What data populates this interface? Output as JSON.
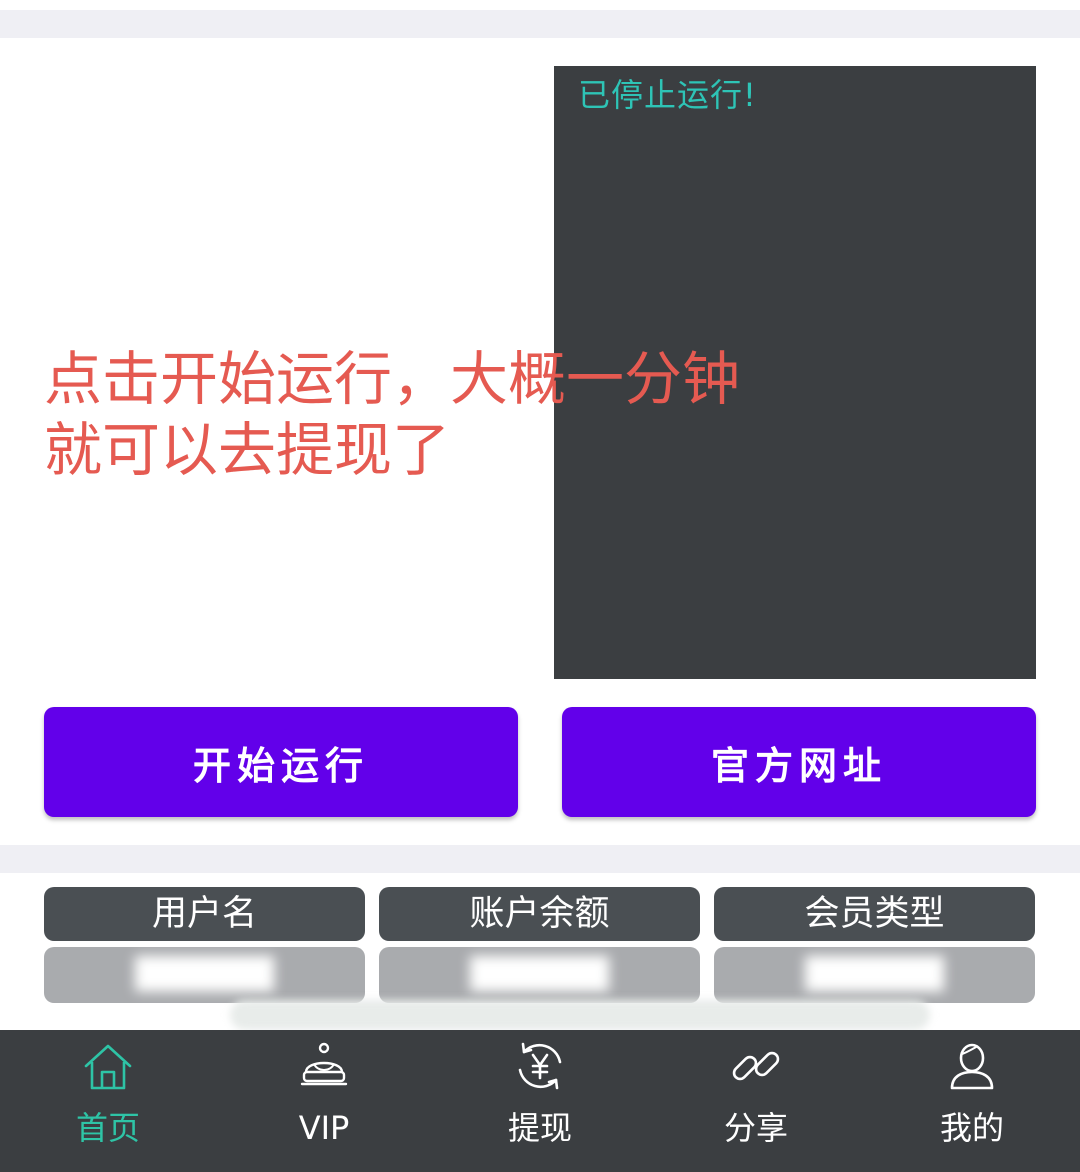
{
  "console": {
    "status_text": "已停止运行!"
  },
  "overlay_note": {
    "line1": "点击开始运行，大概一分钟",
    "line2": "就可以去提现了"
  },
  "actions": {
    "start_label": "开始运行",
    "site_label": "官方网址"
  },
  "account_info": {
    "headers": [
      "用户名",
      "账户余额",
      "会员类型"
    ],
    "values": [
      "██████",
      "██████",
      "██████"
    ]
  },
  "tabbar": {
    "active_index": 0,
    "items": [
      {
        "label": "首页",
        "icon": "home-icon"
      },
      {
        "label": "VIP",
        "icon": "crown-icon"
      },
      {
        "label": "提现",
        "icon": "yuan-exchange-icon"
      },
      {
        "label": "分享",
        "icon": "link-icon"
      },
      {
        "label": "我的",
        "icon": "user-icon"
      }
    ]
  },
  "colors": {
    "accent_button": "#6200ea",
    "console_bg": "#3b3e41",
    "status_text": "#2ec4b6",
    "tab_active": "#2ec4a6",
    "note_text": "#e55a51"
  }
}
